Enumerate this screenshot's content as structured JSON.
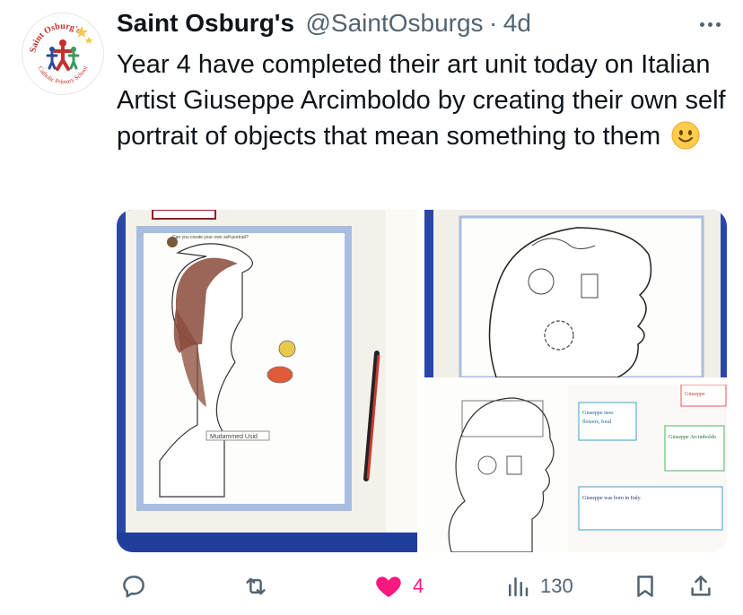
{
  "tweet": {
    "author_name": "Saint Osburg's",
    "author_handle": "@SaintOsburgs",
    "separator": "·",
    "time": "4d",
    "text": "Year 4 have completed their art unit today on Italian Artist Giuseppe Arcimboldo  by creating their own self portrait of objects that mean something to them",
    "emoji": "smiling-face-emoji"
  },
  "avatar": {
    "logo_text_top": "Saint Osburg's",
    "logo_text_bottom": "Catholic Primary School",
    "colors": [
      "#c4312d",
      "#f2c94c",
      "#2e4a9a"
    ]
  },
  "media": {
    "photo_count": 3,
    "photo_1": {
      "worksheet_title": "Can you create your own self-portrait?",
      "name_label": "Mudammed Usid"
    },
    "photo_2": {},
    "photo_3": {
      "note_1": "Giuseppe uses flowers, food, animals and books for his paintings",
      "note_2": "Giuseppe Arcimboldo created paintings to represent the flowers, fire, water, earth and air",
      "note_3": "Giuseppe was born in Italy. He uses oil paints because it is more thick. He has one of his paintings very famous. Earth is was representing a turtle on a doll.",
      "note_4": "Giuseppe Italian"
    }
  },
  "actions": {
    "reply_count": "",
    "retweet_count": "",
    "like_count": "4",
    "views_count": "130",
    "liked": true
  },
  "colors": {
    "like": "#f91880",
    "secondary_text": "#536471",
    "primary_text": "#0f1419"
  }
}
